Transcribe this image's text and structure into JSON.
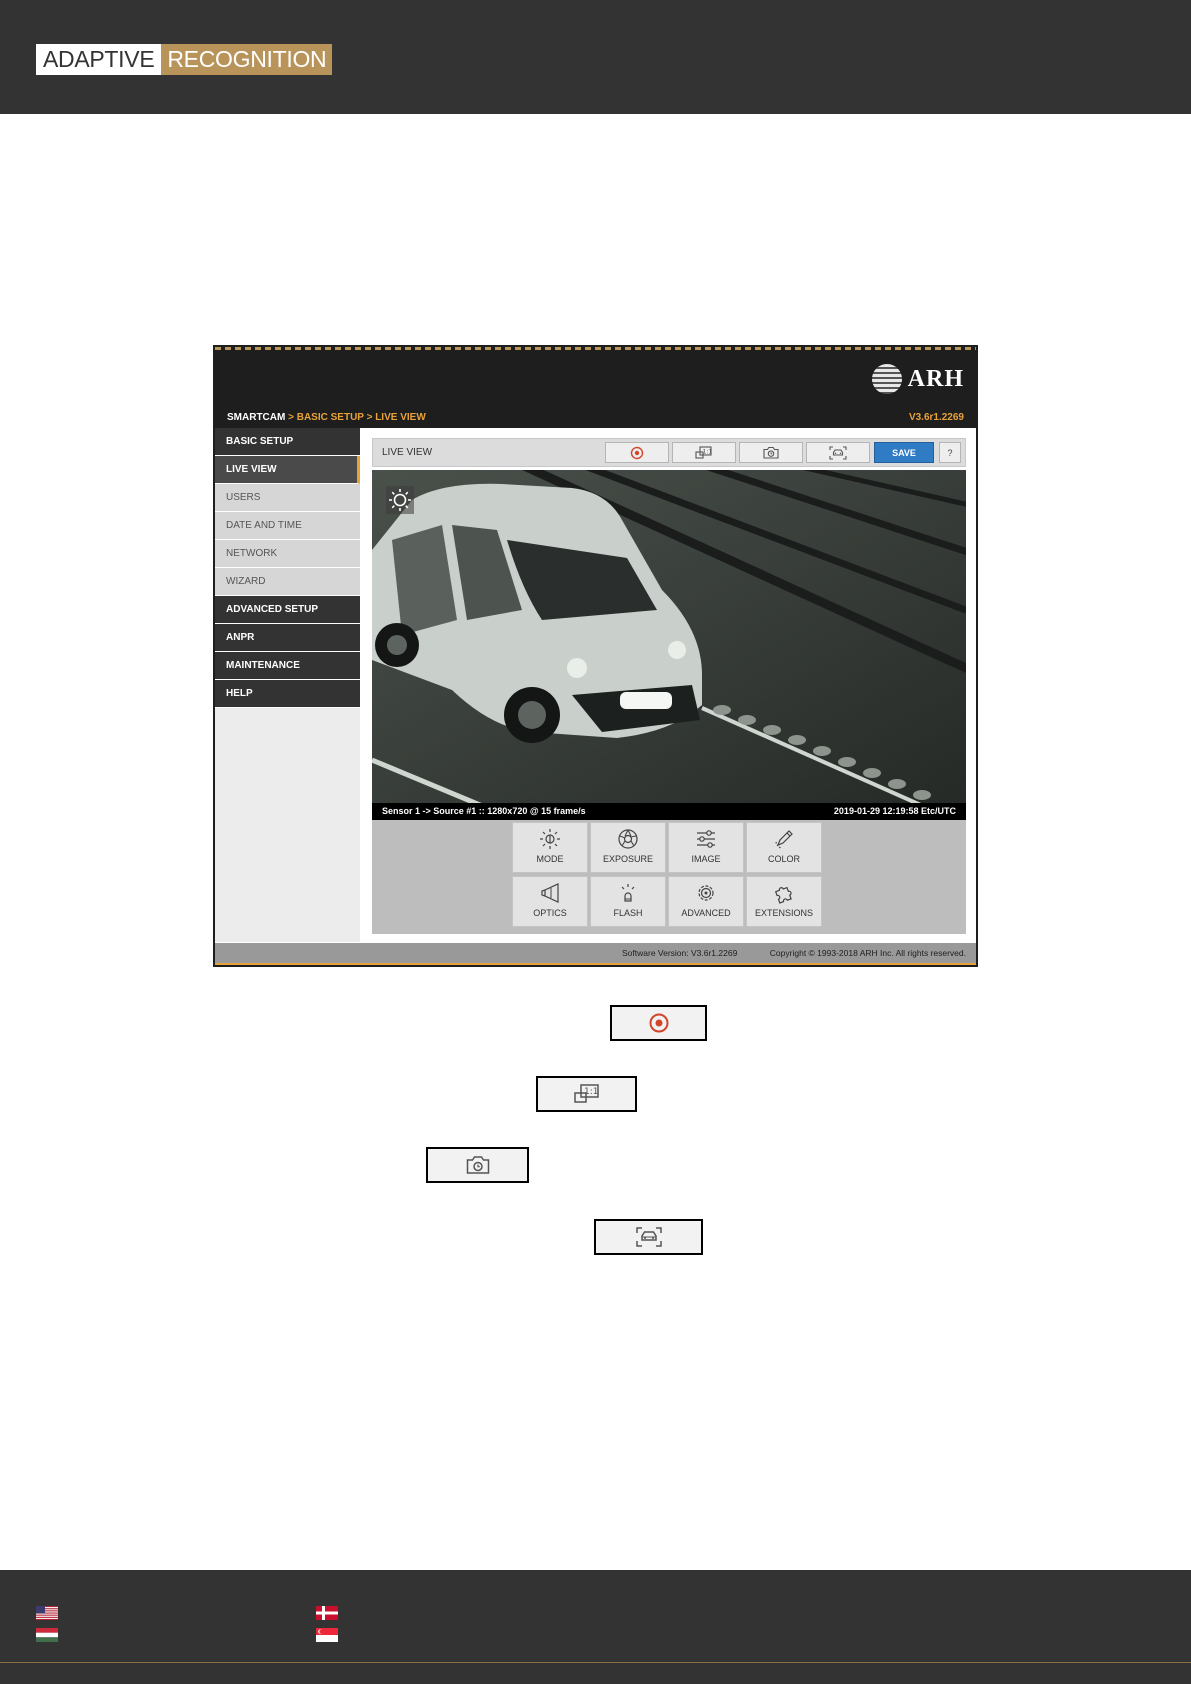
{
  "header": {
    "logo_left": "ADAPTIVE",
    "logo_right": "RECOGNITION",
    "accent_color": "#b9945a",
    "background_color": "#333333"
  },
  "app": {
    "brand": "ARH",
    "breadcrumb": {
      "root": "SMARTCAM",
      "separator": " > ",
      "section": "BASIC SETUP",
      "page": "LIVE VIEW"
    },
    "version": "V3.6r1.2269",
    "accent_color": "#e8a23a",
    "sidebar": {
      "items": [
        {
          "label": "BASIC SETUP",
          "style": "dark"
        },
        {
          "label": "LIVE VIEW",
          "style": "active"
        },
        {
          "label": "USERS",
          "style": "light"
        },
        {
          "label": "DATE AND TIME",
          "style": "light"
        },
        {
          "label": "NETWORK",
          "style": "light"
        },
        {
          "label": "WIZARD",
          "style": "light"
        },
        {
          "label": "ADVANCED SETUP",
          "style": "dark"
        },
        {
          "label": "ANPR",
          "style": "dark"
        },
        {
          "label": "MAINTENANCE",
          "style": "dark"
        },
        {
          "label": "HELP",
          "style": "dark"
        }
      ]
    },
    "toolbar": {
      "title": "LIVE VIEW",
      "buttons": [
        {
          "icon": "record-icon"
        },
        {
          "icon": "one-to-one-zoom-icon"
        },
        {
          "icon": "snapshot-camera-icon"
        },
        {
          "icon": "vehicle-detection-icon"
        }
      ],
      "save_label": "SAVE",
      "help_label": "?",
      "save_color": "#2f7bc4"
    },
    "video": {
      "overlay_icon": "brightness-sun-icon",
      "status_left": "Sensor 1 -> Source #1 :: 1280x720 @ 15 frame/s",
      "status_right": "2019-01-29 12:19:58 Etc/UTC"
    },
    "controls": [
      {
        "label": "MODE",
        "icon": "mode-sun-icon"
      },
      {
        "label": "EXPOSURE",
        "icon": "exposure-aperture-icon"
      },
      {
        "label": "IMAGE",
        "icon": "image-sliders-icon"
      },
      {
        "label": "COLOR",
        "icon": "color-pencil-icon"
      },
      {
        "label": "OPTICS",
        "icon": "optics-lens-icon"
      },
      {
        "label": "FLASH",
        "icon": "flash-bulb-icon"
      },
      {
        "label": "ADVANCED",
        "icon": "advanced-gear-icon"
      },
      {
        "label": "EXTENSIONS",
        "icon": "extensions-puzzle-icon"
      }
    ],
    "footer": {
      "software_version": "Software Version:   V3.6r1.2269",
      "copyright": "Copyright © 1993-2018 ARH Inc. All rights reserved."
    }
  },
  "callouts": [
    {
      "icon": "record-icon"
    },
    {
      "icon": "one-to-one-zoom-icon"
    },
    {
      "icon": "snapshot-camera-icon"
    },
    {
      "icon": "vehicle-detection-icon"
    }
  ],
  "footer": {
    "flags": [
      "us-flag-icon",
      "denmark-flag-icon",
      "hungary-flag-icon",
      "singapore-flag-icon"
    ]
  }
}
